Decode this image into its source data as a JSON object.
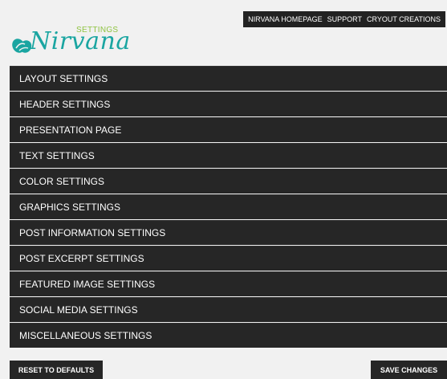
{
  "top_links": [
    "NIRVANA HOMEPAGE",
    "SUPPORT",
    "CRYOUT CREATIONS"
  ],
  "logo": {
    "settings_label": "SETTINGS",
    "name": "Nirvana",
    "mark_icon": "flower-logo-icon",
    "colors": {
      "name": "#1aa5a1",
      "settings": "#8fc342"
    }
  },
  "menu": [
    "LAYOUT SETTINGS",
    "HEADER SETTINGS",
    "PRESENTATION PAGE",
    "TEXT SETTINGS",
    "COLOR SETTINGS",
    "GRAPHICS SETTINGS",
    "POST INFORMATION SETTINGS",
    "POST EXCERPT SETTINGS",
    "FEATURED IMAGE SETTINGS",
    "SOCIAL MEDIA SETTINGS",
    "MISCELLANEOUS SETTINGS"
  ],
  "buttons": {
    "reset_label": "RESET TO DEFAULTS",
    "save_label": "SAVE CHANGES"
  },
  "colors": {
    "bar_background": "#262626",
    "page_background": "#f1f1f1"
  }
}
